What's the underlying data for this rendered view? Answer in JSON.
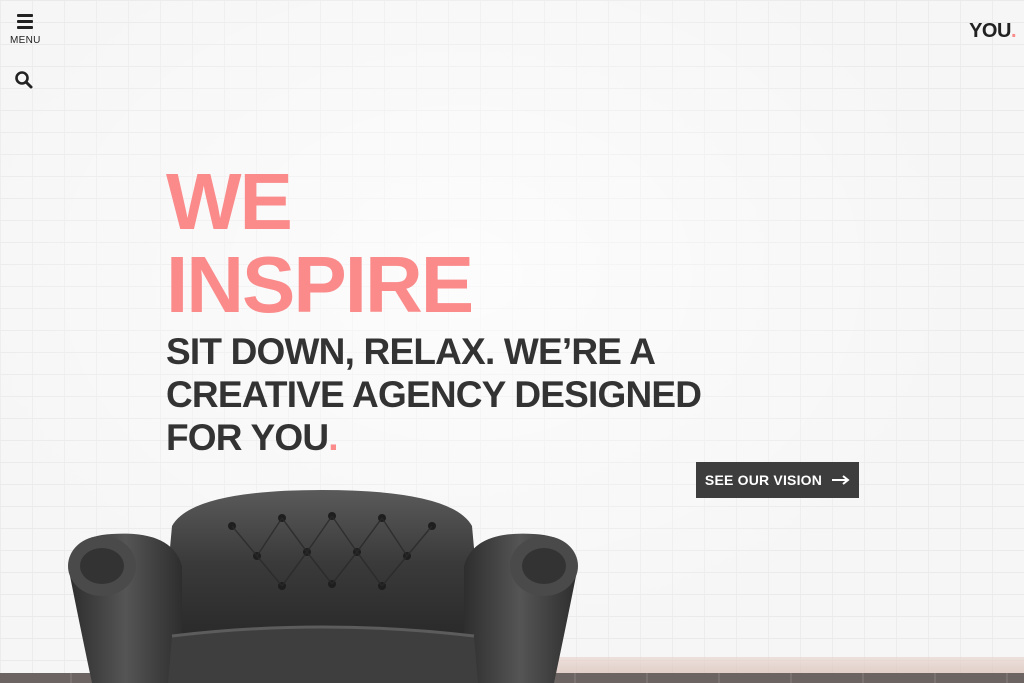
{
  "nav": {
    "menu_label": "MENU",
    "menu_icon": "hamburger-icon",
    "search_icon": "search-icon"
  },
  "brand": {
    "logo_text": "YOU",
    "logo_dot": "."
  },
  "hero": {
    "headline_line1": "WE",
    "headline_line2": "INSPIRE",
    "subheadline": "SIT DOWN, RELAX. WE’RE A CREATIVE AGENCY DESIGNED FOR YOU",
    "subheadline_dot": ".",
    "cta_label": "SEE OUR VISION",
    "cta_icon": "arrow-right-icon"
  },
  "colors": {
    "accent": "#fb8a8a",
    "text_dark": "#333333",
    "button_bg": "#3d3d3d"
  }
}
